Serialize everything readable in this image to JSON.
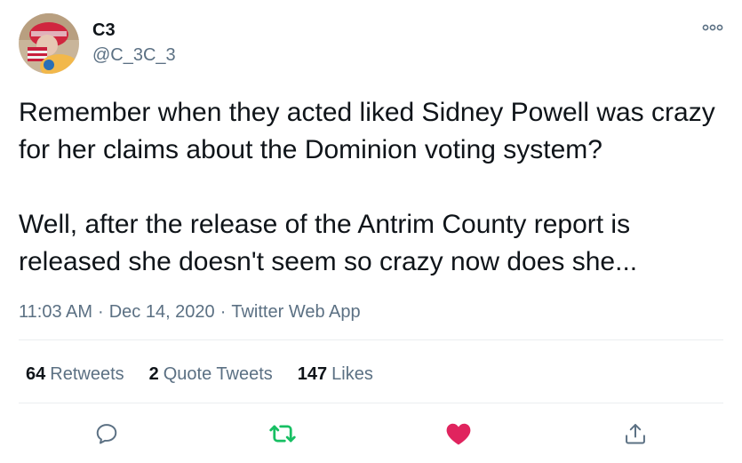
{
  "user": {
    "display_name": "C3",
    "handle": "@C_3C_3",
    "avatar_icon": "avatar-image"
  },
  "tweet": {
    "text": "Remember when they acted liked Sidney Powell was crazy for her claims about the Dominion voting system?\n\nWell, after the release of the Antrim County report is released she doesn't seem so crazy now does she...",
    "time": "11:03 AM",
    "date": "Dec 14, 2020",
    "source": "Twitter Web App",
    "separator": "·"
  },
  "stats": {
    "retweets": {
      "count": "64",
      "label": "Retweets"
    },
    "quote_tweets": {
      "count": "2",
      "label": "Quote Tweets"
    },
    "likes": {
      "count": "147",
      "label": "Likes"
    }
  },
  "actions": {
    "reply_icon": "reply-icon",
    "retweet_icon": "retweet-icon",
    "like_icon": "heart-icon",
    "share_icon": "share-icon",
    "retweet_active": true,
    "like_active": true
  },
  "colors": {
    "text_primary": "#0f1419",
    "text_secondary": "#5b7083",
    "retweet_green": "#17bf63",
    "like_pink": "#e0245e",
    "icon_gray": "#5b7083",
    "divider": "#ebeef0"
  }
}
